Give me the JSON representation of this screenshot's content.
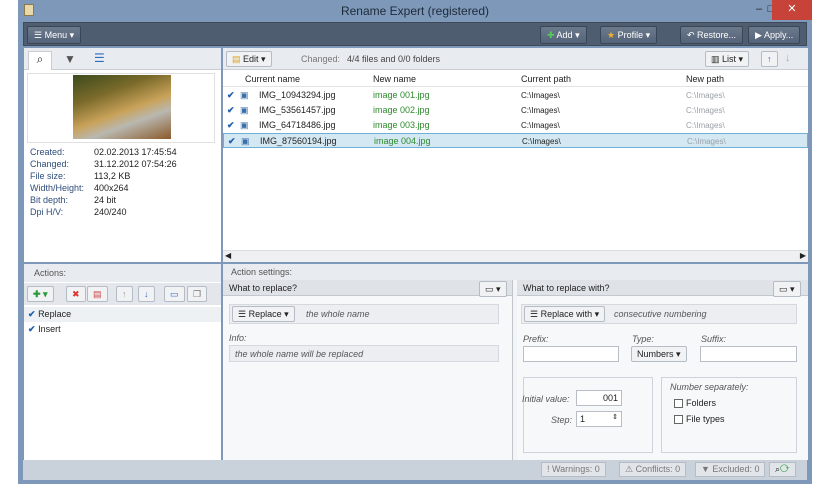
{
  "window": {
    "title": "Rename Expert (registered)",
    "minimize": "–",
    "maximize": "□",
    "close": "✕"
  },
  "toolbar": {
    "menu": "Menu",
    "add": "Add",
    "profile": "Profile",
    "restore": "Restore...",
    "apply": "Apply..."
  },
  "files": {
    "edit": "Edit",
    "changed_label": "Changed:",
    "changed_value": "4/4 files and 0/0 folders",
    "view": "List",
    "columns": [
      "Current name",
      "New name",
      "Current path",
      "New path"
    ],
    "rows": [
      {
        "current": "IMG_10943294.jpg",
        "new": "image 001.jpg",
        "path": "C:\\Images\\",
        "newpath": "C:\\Images\\"
      },
      {
        "current": "IMG_53561457.jpg",
        "new": "image 002.jpg",
        "path": "C:\\Images\\",
        "newpath": "C:\\Images\\"
      },
      {
        "current": "IMG_64718486.jpg",
        "new": "image 003.jpg",
        "path": "C:\\Images\\",
        "newpath": "C:\\Images\\"
      },
      {
        "current": "IMG_87560194.jpg",
        "new": "image 004.jpg",
        "path": "C:\\Images\\",
        "newpath": "C:\\Images\\"
      }
    ]
  },
  "info": {
    "fields": [
      {
        "label": "Created:",
        "value": "02.02.2013 17:45:54"
      },
      {
        "label": "Changed:",
        "value": "31.12.2012 07:54:26"
      },
      {
        "label": "File size:",
        "value": "113,2 KB"
      },
      {
        "label": "Width/Height:",
        "value": "400x264"
      },
      {
        "label": "Bit depth:",
        "value": "24 bit"
      },
      {
        "label": "Dpi H/V:",
        "value": "240/240"
      }
    ]
  },
  "actions": {
    "title": "Actions:",
    "items": [
      "Replace",
      "Insert"
    ]
  },
  "settings": {
    "title": "Action settings:",
    "left": {
      "header": "What to replace?",
      "mode": "Replace",
      "mode_desc": "the whole name",
      "info_label": "Info:",
      "info_text": "the whole name will be replaced"
    },
    "right": {
      "header": "What to replace with?",
      "mode": "Replace with",
      "mode_desc": "consecutive numbering",
      "prefix_label": "Prefix:",
      "type_label": "Type:",
      "type_value": "Numbers",
      "suffix_label": "Suffix:",
      "initial_label": "Initial value:",
      "initial_value": "001",
      "step_label": "Step:",
      "step_value": "1",
      "separately_label": "Number separately:",
      "folders": "Folders",
      "filetypes": "File types"
    }
  },
  "status": {
    "warnings": "Warnings: 0",
    "conflicts": "Conflicts: 0",
    "excluded": "Excluded: 0"
  }
}
